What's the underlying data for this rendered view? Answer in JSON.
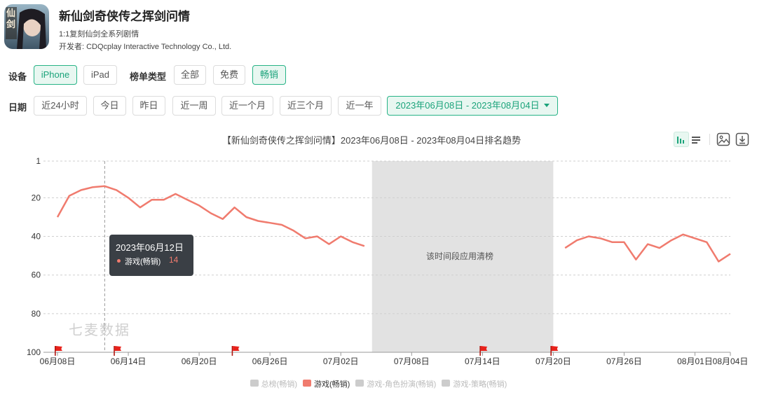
{
  "app": {
    "title": "新仙剑奇侠传之挥剑问情",
    "subtitle": "1:1复刻仙剑全系列剧情",
    "developer": "开发者: CDQcplay Interactive Technology Co., Ltd.",
    "icon_text": "仙剑"
  },
  "filters": {
    "device_label": "设备",
    "devices": [
      "iPhone",
      "iPad"
    ],
    "device_active": "iPhone",
    "list_type_label": "榜单类型",
    "list_types": [
      "全部",
      "免费",
      "畅销"
    ],
    "list_type_active": "畅销",
    "date_label": "日期",
    "date_options": [
      "近24小时",
      "今日",
      "昨日",
      "近一周",
      "近一个月",
      "近三个月",
      "近一年"
    ],
    "date_range": "2023年06月08日 - 2023年08月04日"
  },
  "chart_title": "【新仙剑奇侠传之挥剑问情】2023年06月08日 - 2023年08月04日排名趋势",
  "tooltip": {
    "date": "2023年06月12日",
    "series": "游戏(畅销)",
    "value": "14"
  },
  "watermark": "七麦数据",
  "grey_note": "该时间段应用清榜",
  "icons": [
    "bar-chart-icon",
    "list-icon",
    "image-download-icon",
    "download-icon",
    "red-flag-icon"
  ],
  "colors": {
    "accent": "#1aa37a",
    "series": "#f07b6e",
    "flag": "#e8221b",
    "cleared_band": "#e2e2e2",
    "legend_inactive": "#cccccc"
  },
  "chart_data": {
    "type": "line",
    "title": "【新仙剑奇侠传之挥剑问情】2023年06月08日 - 2023年08月04日排名趋势",
    "x_start": "2023-06-08",
    "x_end": "2023-08-04",
    "x_ticks": [
      "06月08日",
      "06月14日",
      "06月20日",
      "06月26日",
      "07月02日",
      "07月08日",
      "07月14日",
      "07月20日",
      "07月26日",
      "08月01日",
      "08月04日"
    ],
    "y_ticks": [
      "1",
      "20",
      "40",
      "60",
      "80",
      "100"
    ],
    "ylim": [
      1,
      100
    ],
    "y_inverted": true,
    "grid": true,
    "legend_position": "bottom",
    "series": [
      {
        "name": "游戏(畅销)",
        "color": "#f07b6e",
        "points": [
          [
            "2023-06-08",
            30
          ],
          [
            "2023-06-09",
            19
          ],
          [
            "2023-06-10",
            16
          ],
          [
            "2023-06-11",
            14.5
          ],
          [
            "2023-06-12",
            14
          ],
          [
            "2023-06-13",
            16
          ],
          [
            "2023-06-14",
            20
          ],
          [
            "2023-06-15",
            25
          ],
          [
            "2023-06-16",
            21
          ],
          [
            "2023-06-17",
            21
          ],
          [
            "2023-06-18",
            18
          ],
          [
            "2023-06-19",
            21
          ],
          [
            "2023-06-20",
            24
          ],
          [
            "2023-06-21",
            28
          ],
          [
            "2023-06-22",
            31
          ],
          [
            "2023-06-23",
            25
          ],
          [
            "2023-06-24",
            30
          ],
          [
            "2023-06-25",
            32
          ],
          [
            "2023-06-26",
            33
          ],
          [
            "2023-06-27",
            34
          ],
          [
            "2023-06-28",
            37
          ],
          [
            "2023-06-29",
            41
          ],
          [
            "2023-06-30",
            40
          ],
          [
            "2023-07-01",
            44
          ],
          [
            "2023-07-02",
            40
          ],
          [
            "2023-07-03",
            43
          ],
          [
            "2023-07-04",
            45
          ],
          [
            "2023-07-21",
            46
          ],
          [
            "2023-07-22",
            42
          ],
          [
            "2023-07-23",
            40
          ],
          [
            "2023-07-24",
            41
          ],
          [
            "2023-07-25",
            43
          ],
          [
            "2023-07-26",
            43
          ],
          [
            "2023-07-27",
            52
          ],
          [
            "2023-07-28",
            44
          ],
          [
            "2023-07-29",
            46
          ],
          [
            "2023-07-30",
            42
          ],
          [
            "2023-07-31",
            39
          ],
          [
            "2023-08-01",
            41
          ],
          [
            "2023-08-02",
            43
          ],
          [
            "2023-08-03",
            53
          ],
          [
            "2023-08-04",
            49
          ]
        ]
      }
    ],
    "cleared_range": [
      "2023-07-05",
      "2023-07-20"
    ],
    "cleared_label": "该时间段应用清榜",
    "flags": [
      "2023-06-08",
      "2023-06-13",
      "2023-06-23",
      "2023-07-14",
      "2023-07-20"
    ],
    "legend": [
      {
        "name": "总榜(畅销)",
        "active": false
      },
      {
        "name": "游戏(畅销)",
        "active": true
      },
      {
        "name": "游戏-角色扮演(畅销)",
        "active": false
      },
      {
        "name": "游戏-策略(畅销)",
        "active": false
      }
    ],
    "highlight": {
      "date": "2023-06-12",
      "value": 14
    }
  }
}
